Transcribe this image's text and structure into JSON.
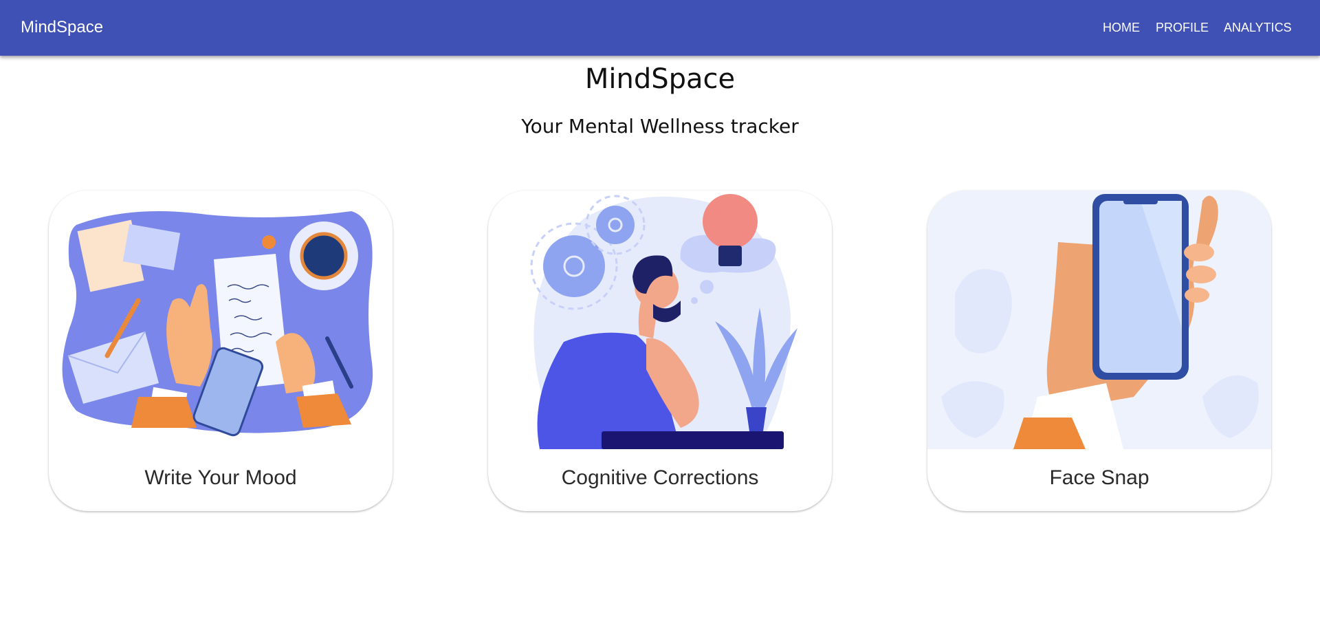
{
  "navbar": {
    "brand": "MindSpace",
    "links": [
      {
        "label": "HOME"
      },
      {
        "label": "PROFILE"
      },
      {
        "label": "ANALYTICS"
      }
    ],
    "color": "#3f51b5"
  },
  "hero": {
    "title": "MindSpace",
    "subtitle": "Your Mental Wellness tracker"
  },
  "cards": [
    {
      "label": "Write Your Mood",
      "illustration": "journaling-desk-illustration"
    },
    {
      "label": "Cognitive Corrections",
      "illustration": "thinking-person-illustration"
    },
    {
      "label": "Face Snap",
      "illustration": "hand-holding-phone-illustration"
    }
  ]
}
